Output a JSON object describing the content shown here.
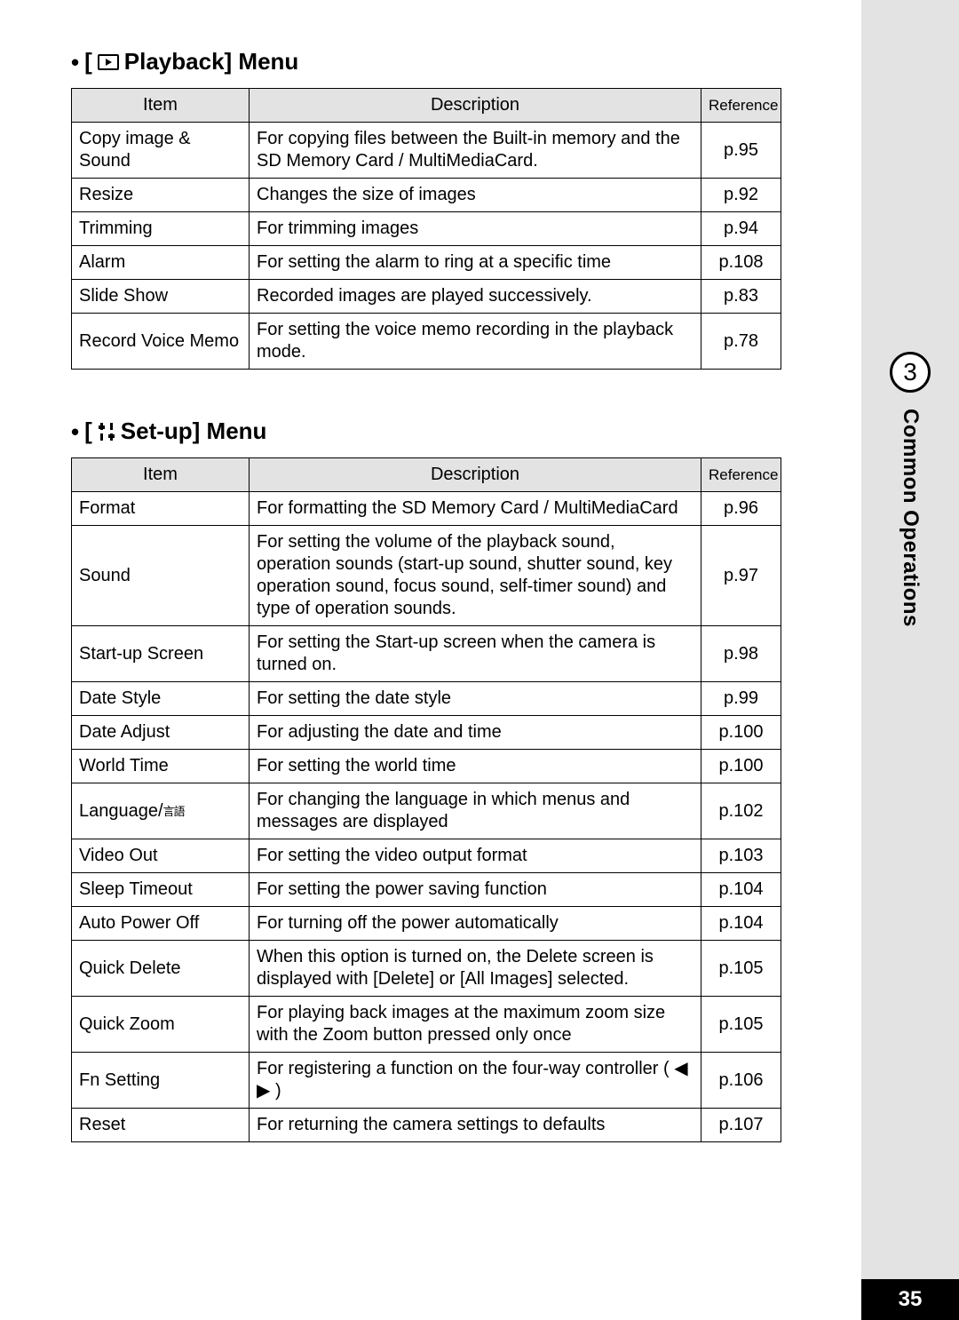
{
  "chapter": {
    "number": "3",
    "title": "Common Operations",
    "page_number": "35"
  },
  "playback_menu": {
    "heading_prefix": "•",
    "heading_text": "Playback] Menu",
    "icon_name": "playback-icon",
    "columns": {
      "item": "Item",
      "description": "Description",
      "reference": "Reference"
    },
    "rows": [
      {
        "item": "Copy image & Sound",
        "desc": "For copying files between the Built-in memory and the SD Memory Card / MultiMediaCard.",
        "ref": "p.95"
      },
      {
        "item": "Resize",
        "desc": "Changes the size of images",
        "ref": "p.92"
      },
      {
        "item": "Trimming",
        "desc": "For trimming images",
        "ref": "p.94"
      },
      {
        "item": "Alarm",
        "desc": "For setting the alarm to ring at a specific time",
        "ref": "p.108"
      },
      {
        "item": "Slide Show",
        "desc": "Recorded images are played successively.",
        "ref": "p.83"
      },
      {
        "item": "Record Voice Memo",
        "desc": "For setting the voice memo recording in the playback mode.",
        "ref": "p.78"
      }
    ]
  },
  "setup_menu": {
    "heading_prefix": "•",
    "heading_text": "Set-up] Menu",
    "icon_name": "setup-icon",
    "columns": {
      "item": "Item",
      "description": "Description",
      "reference": "Reference"
    },
    "rows": [
      {
        "item": "Format",
        "desc": "For formatting the SD Memory Card / MultiMediaCard",
        "ref": "p.96"
      },
      {
        "item": "Sound",
        "desc": "For setting the volume of the playback sound, operation sounds (start-up sound, shutter sound, key operation sound, focus sound, self-timer sound) and type of operation sounds.",
        "ref": "p.97"
      },
      {
        "item": "Start-up Screen",
        "desc": "For setting the Start-up screen when the camera is turned on.",
        "ref": "p.98"
      },
      {
        "item": "Date Style",
        "desc": "For setting the date style",
        "ref": "p.99"
      },
      {
        "item": "Date Adjust",
        "desc": "For adjusting the date and time",
        "ref": "p.100"
      },
      {
        "item": "World Time",
        "desc": "For setting the world time",
        "ref": "p.100"
      },
      {
        "item": "Language/",
        "item_cjk": "言語",
        "desc": "For changing the language in which menus and messages are displayed",
        "ref": "p.102"
      },
      {
        "item": "Video Out",
        "desc": "For setting the video output format",
        "ref": "p.103"
      },
      {
        "item": "Sleep Timeout",
        "desc": "For setting the power saving function",
        "ref": "p.104"
      },
      {
        "item": "Auto Power Off",
        "desc": "For turning off the power automatically",
        "ref": "p.104"
      },
      {
        "item": "Quick Delete",
        "desc": "When this option is turned on, the Delete screen is displayed with [Delete] or [All Images] selected.",
        "ref": "p.105"
      },
      {
        "item": "Quick Zoom",
        "desc": "For playing back images at the maximum zoom size with the Zoom button pressed only once",
        "ref": "p.105"
      },
      {
        "item": "Fn Setting",
        "desc": "For registering a function on the four-way controller ( ◀ ▶ )",
        "ref": "p.106"
      },
      {
        "item": "Reset",
        "desc": "For returning the camera settings to defaults",
        "ref": "p.107"
      }
    ]
  }
}
